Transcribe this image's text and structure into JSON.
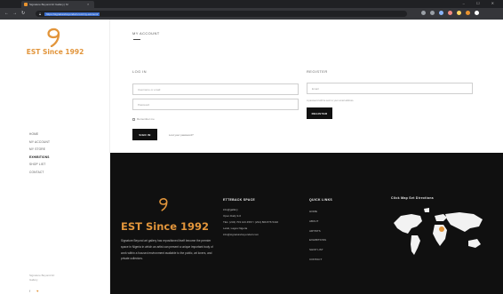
{
  "browser": {
    "tab_title": "Signature Beyond Art Gallery | M",
    "url": "https://signaturebeyondart.com/my-account/",
    "window_controls": "– ☐ ✕",
    "extension_colors": [
      "#9aa0a6",
      "#9aa0a6",
      "#8ab4f8",
      "#f28b82",
      "#fdd663",
      "#e8932f",
      "#ffffff"
    ]
  },
  "sidebar": {
    "logo_text": "EST Since 1992",
    "nav": [
      {
        "label": "HOME",
        "active": false
      },
      {
        "label": "MY ACCOUNT",
        "active": false
      },
      {
        "label": "MY STORE",
        "active": false
      },
      {
        "label": "EXHIBITIONS",
        "active": true
      },
      {
        "label": "SHOP LIST",
        "active": false
      },
      {
        "label": "CONTACT",
        "active": false
      }
    ],
    "note_lines": [
      "Signature Beyond Art",
      "Gallery"
    ],
    "social": [
      "f",
      "♥"
    ]
  },
  "account": {
    "title": "MY ACCOUNT",
    "login": {
      "heading": "LOG IN",
      "username_placeholder": "Username or email",
      "password_placeholder": "Password",
      "remember_label": "Remember me",
      "button": "SIGN IN",
      "lost_password": "Lost your password?"
    },
    "register": {
      "heading": "REGISTER",
      "email_placeholder": "Email",
      "privacy_note": "A password will be sent to your email address.",
      "button": "REGISTER"
    }
  },
  "footer": {
    "logo_text": "EST Since 1992",
    "about": "Signature Beyond art gallery has repositioned itself become the premier space in Nigeria in which an artist can present a unique important body of work within a focused environment available to the public, art lovers, and private collectors.",
    "address": {
      "heading": "ETTEBACK SPACE",
      "lines": [
        "info@gallery",
        "Open Daily 9-6",
        "TEL: (234) 703 123 4567 / (234) 809 876 5432",
        "Lekki, Lagos Nigeria",
        "info@signaturebeyondart.com"
      ]
    },
    "quick_links": {
      "heading": "QUICK LINKS",
      "items": [
        "HOME",
        "ABOUT",
        "ARTISTS",
        "EXHIBITIONS",
        "SHOP LIST",
        "CONTACT"
      ]
    },
    "map": {
      "heading": "Click Map Set Directions"
    }
  },
  "colors": {
    "brand_orange": "#e2953b",
    "footer_bg": "#101010",
    "button_bg": "#111111"
  }
}
